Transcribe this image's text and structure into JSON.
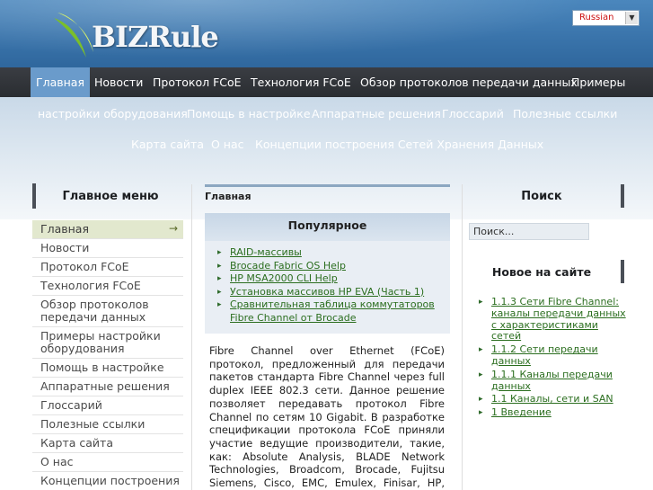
{
  "header": {
    "logo_text": "BIZRule",
    "language": "Russian"
  },
  "nav": {
    "items": [
      "Главная",
      "Новости",
      "Протокол FCoE",
      "Технология FCoE",
      "Обзор протоколов передачи данных",
      "Примеры"
    ],
    "sub_items": [
      "настройки оборудования",
      "Помощь в настройке",
      "Аппаратные решения",
      "Глоссарий",
      "Полезные ссылки",
      "Карта сайта",
      "О нас",
      "Концепции построения Сетей Хранения Данных"
    ]
  },
  "left": {
    "title": "Главное меню",
    "menu": [
      "Главная",
      "Новости",
      "Протокол FCoE",
      "Технология FCoE",
      "Обзор протоколов передачи данных",
      "Примеры настройки оборудования",
      "Помощь в настройке",
      "Аппаратные решения",
      "Глоссарий",
      "Полезные ссылки",
      "Карта сайта",
      "О нас",
      "Концепции построения"
    ],
    "active_arrow": "→"
  },
  "center": {
    "breadcrumb": "Главная",
    "popular_title": "Популярное",
    "popular": [
      "RAID-массивы",
      "Brocade Fabric OS Help",
      "HP MSA2000 CLI Help",
      "Установка массивов HP EVA (Часть 1)",
      "Сравнительная таблица коммутаторов Fibre Channel от Brocade"
    ],
    "article": "Fibre Channel over Ethernet (FCoE) протокол, предложенный для передачи пакетов стандарта Fibre Channel через full duplex IEEE 802.3 сети. Данное решение позволяет передавать протокол Fibre Channel по сетям 10 Gigabit. В разработке спецификации протокола FCoE приняли участие ведущие производители, такие, как: Absolute Analysis, BLADE Network Technologies, Broadcom, Brocade, Fujitsu Siemens, Cisco, EMC, Emulex, Finisar, HP, IBM, Intel, Hitachi Data Systems,"
  },
  "right": {
    "search_title": "Поиск",
    "search_value": "Поиск...",
    "new_title": "Новое на сайте",
    "new_items": [
      "1.1.3 Сети Fibre Channel: каналы передачи данных с характеристиками сетей",
      "1.1.2 Сети передачи данных",
      "1.1.1 Каналы передачи данных",
      "1.1 Каналы, сети и SAN",
      "1 Введение"
    ]
  },
  "colors": {
    "nav_bg": "#2f3236",
    "nav_active": "#6a9bcb",
    "link": "#2b6e1f",
    "menu_active": "#e2e8ce"
  }
}
